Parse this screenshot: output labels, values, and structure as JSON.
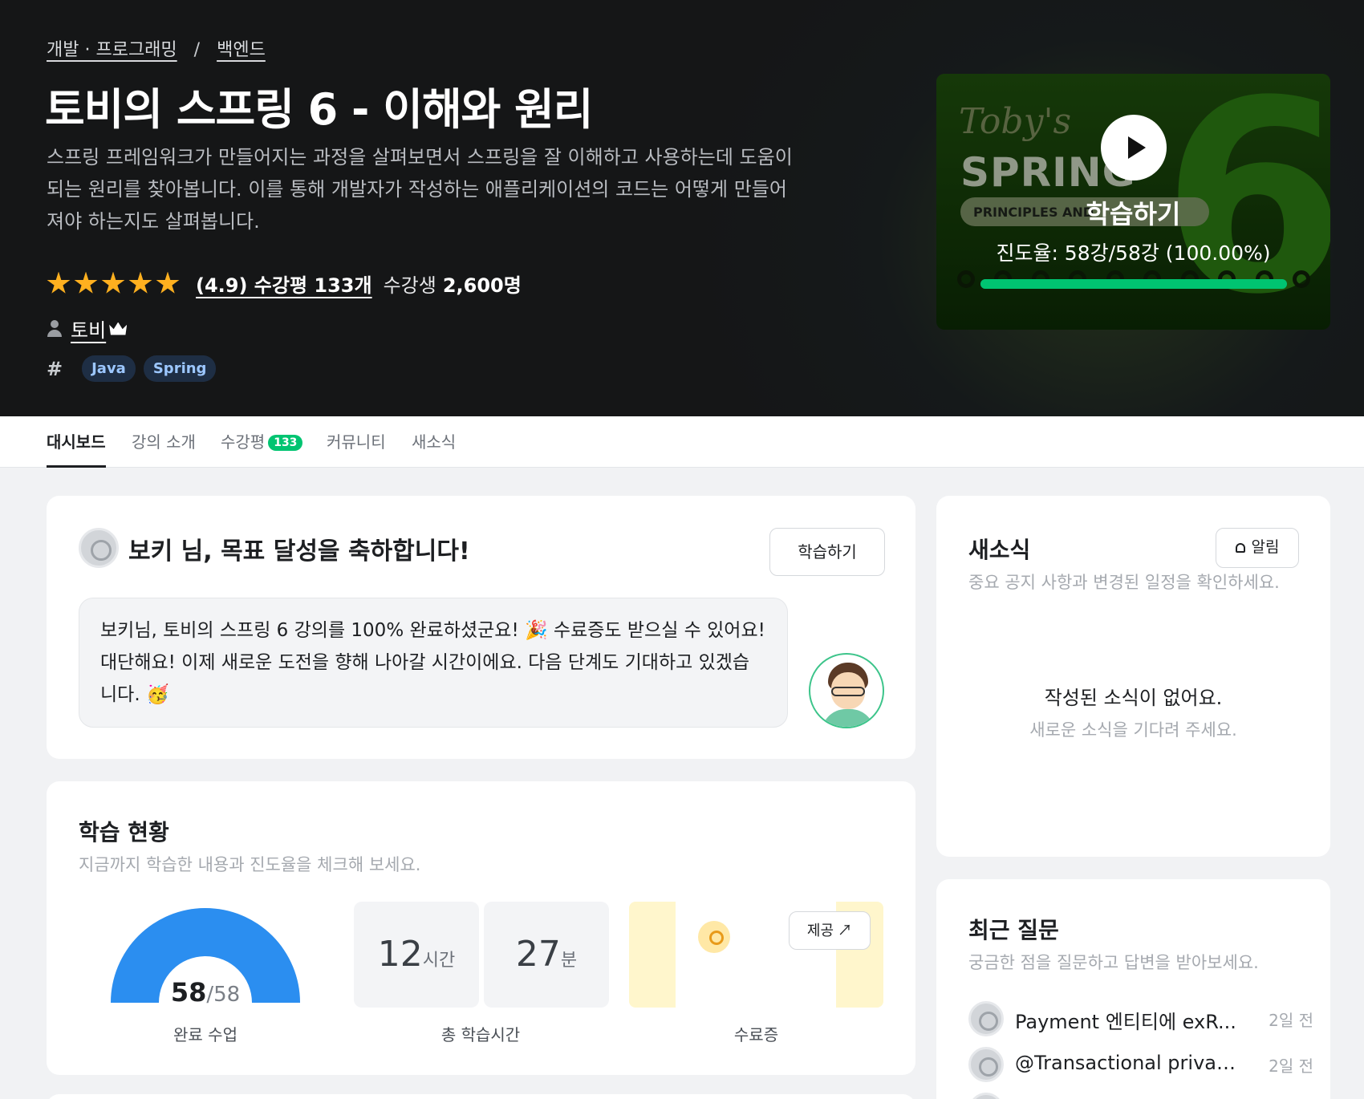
{
  "hero": {
    "breadcrumb": [
      "개발 · 프로그래밍",
      "백엔드"
    ],
    "breadcrumb_sep": "/",
    "title": "토비의 스프링 6 - 이해와 원리",
    "description": "스프링 프레임워크가 만들어지는 과정을 살펴보면서 스프링을 잘 이해하고 사용하는데 도움이 되는 원리를 찾아봅니다. 이를 통해 개발자가 작성하는 애플리케이션의 코드는 어떻게 만들어져야 하는지도 살펴봅니다.",
    "rating": 4.9,
    "rating_link": "(4.9) 수강평 133개",
    "students_label": "수강생",
    "students_count": "2,600명",
    "instructor": "토비",
    "tag_symbol": "#",
    "tags": [
      "Java",
      "Spring"
    ],
    "thumbnail": {
      "cta": "학습하기",
      "progress_text": "진도율: 58강/58강 (100.00%)",
      "progress_value": 1.0,
      "art_tobys": "Toby's",
      "art_spring": "SPRING",
      "art_pill": "PRINCIPLES AND",
      "art_six": "6"
    }
  },
  "tabs": {
    "items": [
      "대시보드",
      "강의 소개",
      "수강평",
      "커뮤니티",
      "새소식"
    ],
    "active": 0,
    "review_badge": "133"
  },
  "congrats": {
    "title": "보키 님, 목표 달성을 축하합니다!",
    "button": "학습하기",
    "message": "보키님, 토비의 스프링 6 강의를 100% 완료하셨군요! 🎉 수료증도 받으실 수 있어요! 대단해요! 이제 새로운 도전을 향해 나아갈 시간이에요. 다음 단계도 기대하고 있겠습니다. 🥳"
  },
  "progress": {
    "title": "학습 현황",
    "subtitle": "지금까지 학습한 내용과 진도율을 체크해 보세요.",
    "completed": 58,
    "total": 58,
    "completed_display": "58",
    "total_display": "/58",
    "completed_label": "완료 수업",
    "hours": "12",
    "hours_unit": "시간",
    "minutes": "27",
    "minutes_unit": "분",
    "time_label": "총 학습시간",
    "cert_button": "제공",
    "cert_label": "수료증"
  },
  "news": {
    "title": "새소식",
    "subtitle": "중요 공지 사항과 변경된 일정을 확인하세요.",
    "alarm_button": "알림",
    "empty_title": "작성된 소식이 없어요.",
    "empty_sub": "새로운 소식을 기다려 주세요."
  },
  "questions": {
    "title": "최근 질문",
    "subtitle": "궁금한 점을 질문하고 답변을 받아보세요.",
    "items": [
      {
        "title": "Payment 엔티티에 exR...",
        "time": "2일 전"
      },
      {
        "title": "@Transactional privat...",
        "time": "2일 전"
      }
    ]
  },
  "colors": {
    "accent_green": "#00c471",
    "gauge_blue": "#2b8ef0",
    "star_yellow": "#ffb01f",
    "hero_bg": "#151617"
  }
}
